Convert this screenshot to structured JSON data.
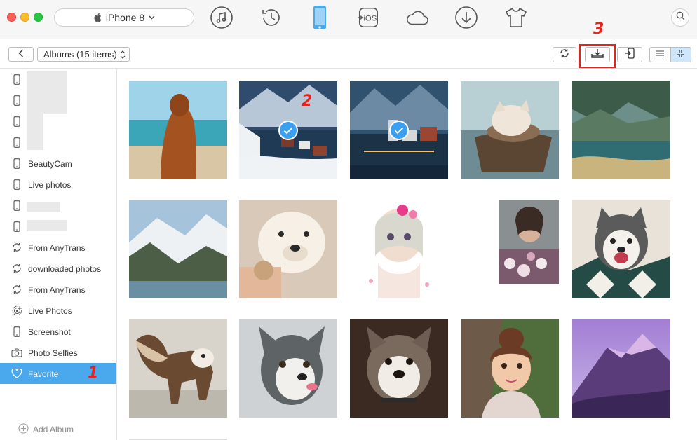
{
  "window": {
    "device_name": "iPhone 8",
    "nav_icons": [
      "music-icon",
      "history-icon",
      "device-icon",
      "to-ios-icon",
      "cloud-icon",
      "download-icon",
      "tshirt-icon"
    ],
    "nav_ios_label": "iOS"
  },
  "toolbar": {
    "album_select": "Albums (15 items)"
  },
  "steps": {
    "one": "1",
    "two": "2",
    "three": "3"
  },
  "sidebar": {
    "items": [
      {
        "label": "",
        "icon": "phone-icon"
      },
      {
        "label": "",
        "icon": "phone-icon"
      },
      {
        "label": "",
        "icon": "phone-icon"
      },
      {
        "label": "",
        "icon": "phone-icon"
      },
      {
        "label": "BeautyCam",
        "icon": "phone-icon"
      },
      {
        "label": "Live photos",
        "icon": "phone-icon"
      },
      {
        "label": "",
        "icon": "phone-icon"
      },
      {
        "label": "",
        "icon": "phone-icon"
      },
      {
        "label": "From AnyTrans",
        "icon": "sync-icon"
      },
      {
        "label": "downloaded photos",
        "icon": "sync-icon"
      },
      {
        "label": "From AnyTrans",
        "icon": "sync-icon"
      },
      {
        "label": "Live Photos",
        "icon": "live-photo-icon"
      },
      {
        "label": "Screenshot",
        "icon": "phone-icon"
      },
      {
        "label": "Photo Selfies",
        "icon": "camera-icon"
      },
      {
        "label": "Favorite",
        "icon": "heart-icon"
      }
    ],
    "add_album": "Add Album"
  },
  "colors": {
    "accent": "#4aa8ec",
    "check": "#3a9ff0",
    "highlight": "#e8231c"
  }
}
